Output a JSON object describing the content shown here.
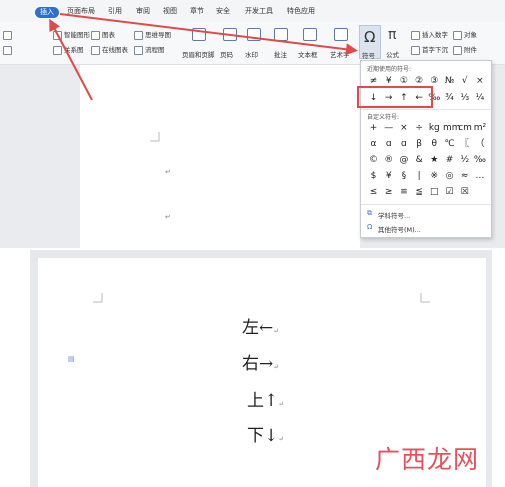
{
  "menubar": {
    "tabs": [
      {
        "label": "插入",
        "active": true
      },
      {
        "label": "页面布局"
      },
      {
        "label": "引用"
      },
      {
        "label": "审阅"
      },
      {
        "label": "视图"
      },
      {
        "label": "章节"
      },
      {
        "label": "安全"
      },
      {
        "label": "开发工具"
      },
      {
        "label": "特色应用"
      }
    ]
  },
  "ribbon": {
    "smart_shape": "智能图形",
    "chart": "图表",
    "mindmap": "思维导图",
    "relation": "关系图",
    "online_chart": "在线图表",
    "flowchart": "流程图",
    "header_footer": "页眉和页脚",
    "page_number": "页码",
    "watermark": "水印",
    "comment": "批注",
    "textbox": "文本框",
    "wordart": "艺术字",
    "symbol": "符号",
    "formula": "公式",
    "insert_number": "插入数字",
    "object": "对象",
    "drop_cap": "首字下沉",
    "attachment": "附件"
  },
  "symbol_dropdown": {
    "recent_label": "近期使用的符号:",
    "recent_row1": [
      "≠",
      "¥",
      "①",
      "②",
      "③",
      "№",
      "√",
      "×"
    ],
    "recent_row2": [
      "↓",
      "→",
      "↑",
      "←",
      "‰",
      "¾",
      "⅓",
      "¼"
    ],
    "custom_label": "自定义符号:",
    "custom_rows": [
      [
        "+",
        "—",
        "×",
        "÷",
        "kg",
        "mm",
        "cm",
        "m²"
      ],
      [
        "α",
        "ɑ",
        "ɑ",
        "β",
        "θ",
        "℃",
        "〖",
        "（"
      ],
      [
        "©",
        "®",
        "@",
        "&",
        "★",
        "#",
        "½",
        "‰"
      ],
      [
        "$",
        "¥",
        "§",
        "|",
        "※",
        "◎",
        "≈",
        "…"
      ],
      [
        "≤",
        "≥",
        "≌",
        "≦",
        "□",
        "☑",
        "☒",
        ""
      ]
    ],
    "subject_symbols": "学科符号...",
    "other_symbols": "其他符号(M)..."
  },
  "document": {
    "lines": [
      {
        "text": "左←",
        "mark": "↵"
      },
      {
        "text": "右→",
        "mark": "↵"
      },
      {
        "text": "上↑",
        "mark": "↵"
      },
      {
        "text": "下↓",
        "mark": "↵"
      }
    ]
  },
  "watermark_text": "广西龙网",
  "colors": {
    "accent": "#2f6fd1",
    "highlight": "#e04a4a"
  }
}
